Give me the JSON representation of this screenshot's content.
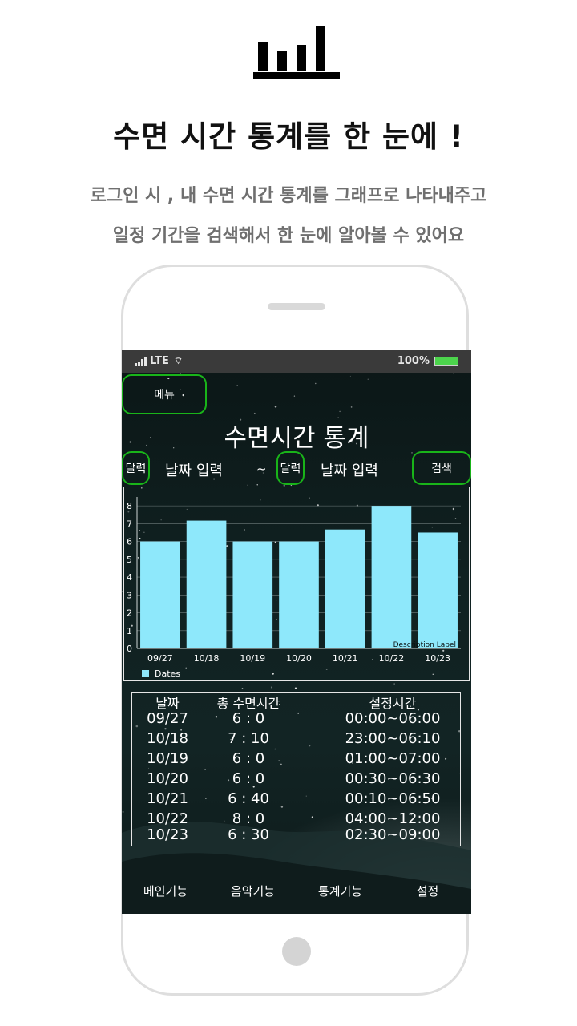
{
  "header": {
    "logo_icon": "bar-chart-icon",
    "headline": "수면 시간 통계를 한 눈에 !",
    "sub_line1": "로그인 시 , 내 수면 시간 통계를 그래프로 나타내주고",
    "sub_line2": "일정 기간을 검색해서 한 눈에 알아볼 수 있어요"
  },
  "statusbar": {
    "network": "LTE",
    "battery": "100%"
  },
  "app": {
    "menu_label": "메뉴",
    "title": "수면시간 통계",
    "calendar_label": "달력",
    "date_placeholder": "날짜 입력",
    "tilde": "~",
    "search_label": "검색",
    "colors": {
      "accent": "#19b419",
      "bar": "#8ee8fb"
    }
  },
  "chart_data": {
    "type": "bar",
    "categories": [
      "09/27",
      "10/18",
      "10/19",
      "10/20",
      "10/21",
      "10/22",
      "10/23"
    ],
    "series": [
      {
        "name": "Dates",
        "values": [
          6.0,
          7.17,
          6.0,
          6.0,
          6.67,
          8.0,
          6.5
        ]
      }
    ],
    "yticks": [
      "0",
      "1",
      "2",
      "3",
      "4",
      "5",
      "6",
      "7",
      "8"
    ],
    "ylim": [
      0,
      8.5
    ],
    "description": "Description Label",
    "legend": "bottom-left",
    "grid": true
  },
  "table": {
    "headers": [
      "날짜",
      "총 수면시간",
      "설정시간"
    ],
    "rows": [
      [
        "09/27",
        "6 : 0",
        "00:00~06:00"
      ],
      [
        "10/18",
        "7 : 10",
        "23:00~06:10"
      ],
      [
        "10/19",
        "6 : 0",
        "01:00~07:00"
      ],
      [
        "10/20",
        "6 : 0",
        "00:30~06:30"
      ],
      [
        "10/21",
        "6 : 40",
        "00:10~06:50"
      ],
      [
        "10/22",
        "8 : 0",
        "04:00~12:00"
      ],
      [
        "10/23",
        "6 : 30",
        "02:30~09:00"
      ]
    ]
  },
  "nav": {
    "items": [
      "메인기능",
      "음악기능",
      "통계기능",
      "설정"
    ]
  }
}
